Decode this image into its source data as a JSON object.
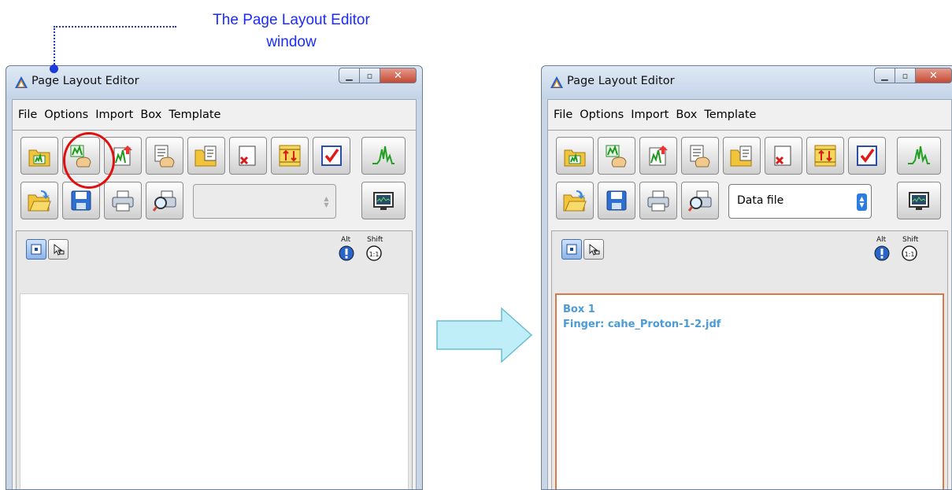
{
  "callout": {
    "line1": "The Page Layout Editor",
    "line2": "window"
  },
  "left_window": {
    "title": "Page Layout Editor",
    "menu": [
      "File",
      "Options",
      "Import",
      "Box",
      "Template"
    ],
    "select_value": "",
    "modifier_alt": "Alt",
    "modifier_shift": "Shift"
  },
  "right_window": {
    "title": "Page Layout Editor",
    "menu": [
      "File",
      "Options",
      "Import",
      "Box",
      "Template"
    ],
    "select_value": "Data file",
    "modifier_alt": "Alt",
    "modifier_shift": "Shift",
    "box_label": "Box 1",
    "box_finger": "Finger: cahe_Proton-1-2.jdf"
  },
  "colors": {
    "callout_text": "#1a2bff",
    "highlight_circle": "#e01010",
    "box_text": "#4a9bd6",
    "box_border": "#d87a48",
    "arrow_fill": "#bfeef8"
  },
  "icons": {
    "toolbar_row1": [
      "open-data-icon",
      "add-finger-icon",
      "add-spectrum-icon",
      "add-text-icon",
      "open-template-icon",
      "delete-box-icon",
      "align-icon",
      "checkmark-icon",
      "spectrum-peaks-icon"
    ],
    "toolbar_row2": [
      "open-folder-icon",
      "save-icon",
      "print-icon",
      "print-preview-icon",
      "monitor-icon"
    ]
  }
}
